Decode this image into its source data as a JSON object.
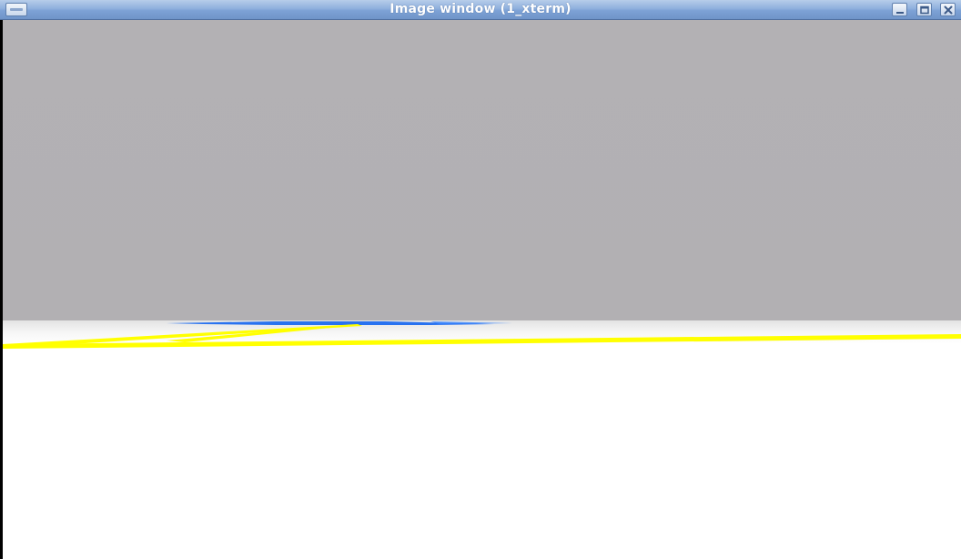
{
  "window": {
    "title": "Image window (1_xterm)",
    "icons": {
      "menu": "window-menu-icon",
      "minimize": "minimize-icon",
      "maximize": "maximize-icon",
      "close": "close-icon"
    }
  },
  "scene": {
    "sky_color": "#b3b1b4",
    "ground_color": "#ffffff",
    "lane_line_color": "#ffff00",
    "detected_segment_color": "#1a6bff"
  }
}
